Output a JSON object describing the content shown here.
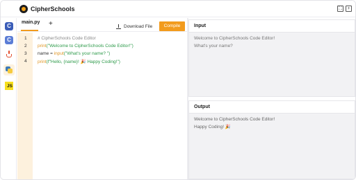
{
  "app": {
    "brand": "CipherSchools"
  },
  "topbar": {
    "fullscreen_icon": "expand-icon",
    "close_icon": "close-icon"
  },
  "sidebar": {
    "languages": [
      {
        "name": "C",
        "icon": "c-icon"
      },
      {
        "name": "C++",
        "icon": "cpp-icon"
      },
      {
        "name": "Java",
        "icon": "java-icon"
      },
      {
        "name": "Python",
        "icon": "python-icon",
        "active": true
      },
      {
        "name": "JS",
        "icon": "js-icon"
      }
    ]
  },
  "editor": {
    "tab_label": "main.py",
    "add_tab_label": "+",
    "download_label": "Download File",
    "compile_label": "Compile",
    "line_numbers": [
      "1",
      "2",
      "3",
      "4"
    ],
    "lines": [
      [
        {
          "t": "# CipherSchools Code Editor",
          "c": "comment"
        }
      ],
      [
        {
          "t": "print",
          "c": "fn"
        },
        {
          "t": "(\"Welcome to CipherSchools Code Editor!\")",
          "c": "str"
        }
      ],
      [
        {
          "t": "name = ",
          "c": "plain"
        },
        {
          "t": "input",
          "c": "fn"
        },
        {
          "t": "(\"What's your name? \")",
          "c": "str"
        }
      ],
      [
        {
          "t": "print",
          "c": "fn"
        },
        {
          "t": "(f\"Hello, {name}! 🎉 Happy Coding!\")",
          "c": "str"
        }
      ]
    ]
  },
  "input_panel": {
    "title": "Input",
    "lines": [
      "Welcome to CipherSchools Code Editor!",
      "What's your name?"
    ]
  },
  "output_panel": {
    "title": "Output",
    "lines": [
      "Welcome to CipherSchools Code Editor!",
      "Happy Coding! 🎉"
    ]
  },
  "colors": {
    "accent": "#f29b1d",
    "gutter": "#fdf1dd",
    "panel_bg": "#f2f2f4"
  }
}
